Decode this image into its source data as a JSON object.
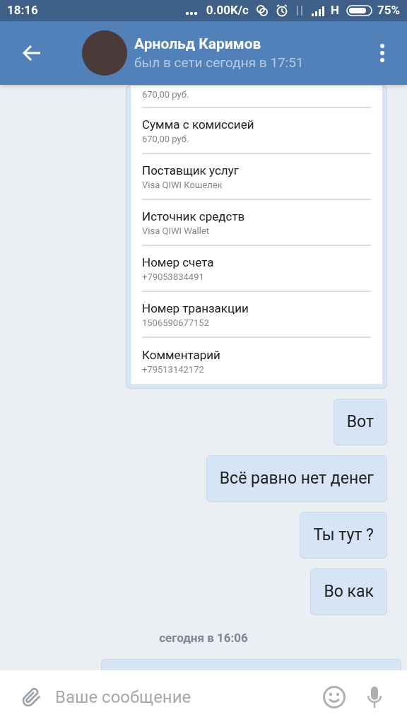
{
  "status_bar": {
    "time": "18:16",
    "speed": "0.00K/c",
    "network": "H",
    "battery": "75%"
  },
  "header": {
    "name": "Арнольд Каримов",
    "status": "был в сети сегодня в 17:51"
  },
  "receipt": {
    "rows": [
      {
        "label": null,
        "value": "670,00 руб."
      },
      {
        "label": "Сумма с комиссией",
        "value": "670,00 руб."
      },
      {
        "label": "Поставщик услуг",
        "value": "Visa QIWI Кошелек"
      },
      {
        "label": "Источник средств",
        "value": "Visa QIWI Wallet"
      },
      {
        "label": "Номер счета",
        "value": "+79053834491"
      },
      {
        "label": "Номер транзакции",
        "value": "1506590677152"
      },
      {
        "label": "Комментарий",
        "value": "+79513142172"
      }
    ]
  },
  "messages": [
    {
      "text": "Вот"
    },
    {
      "text": "Всё равно нет денег"
    },
    {
      "text": "Ты тут ?"
    },
    {
      "text": "Во как"
    }
  ],
  "date_divider": "сегодня в 16:06",
  "composer": {
    "placeholder": "Ваше сообщение"
  }
}
